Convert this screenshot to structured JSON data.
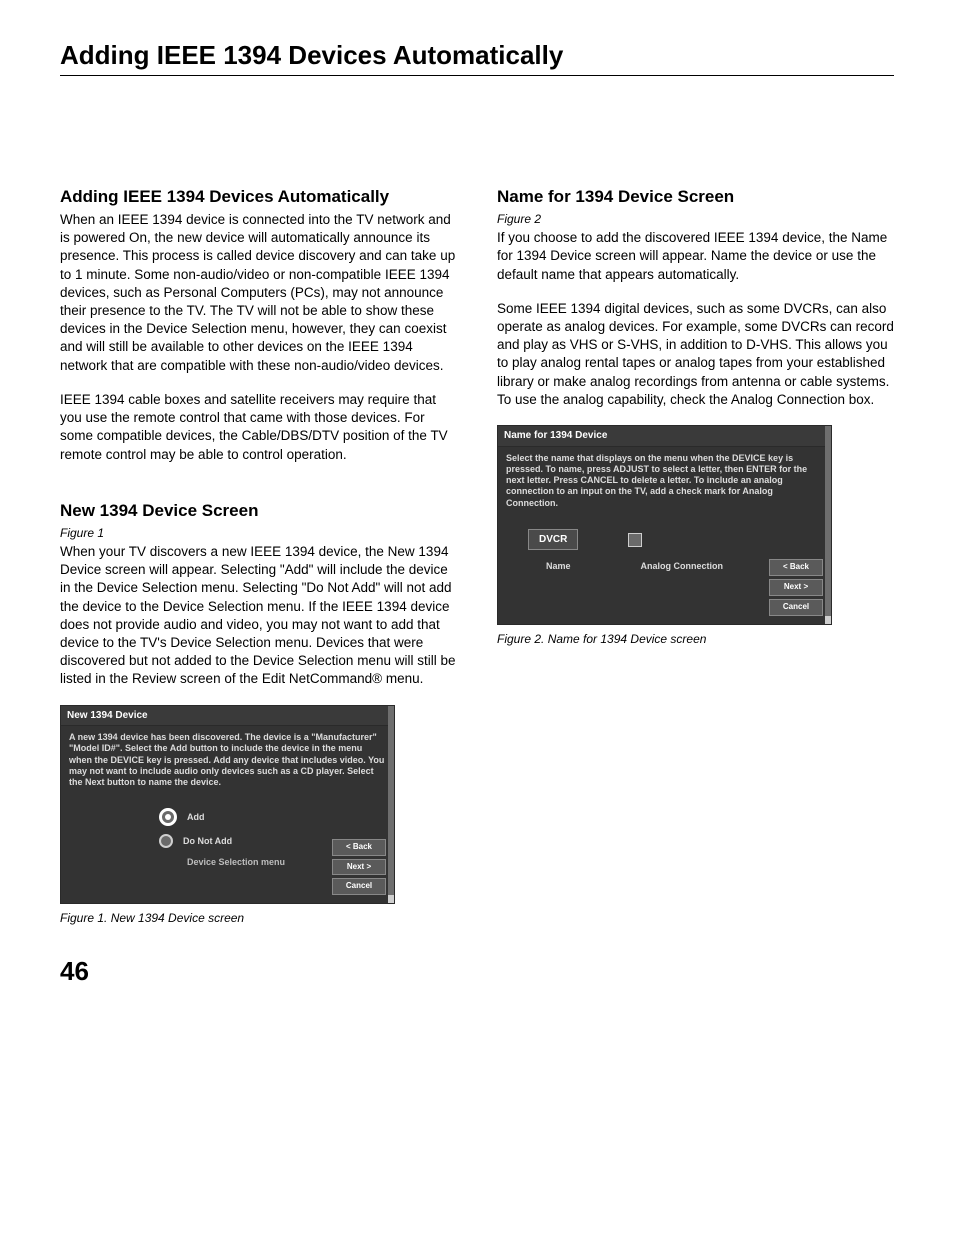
{
  "pageTitle": "Adding IEEE 1394 Devices Automatically",
  "pageNumber": "46",
  "left": {
    "s1": {
      "head": "Adding IEEE 1394 Devices Automatically",
      "p1": "When an IEEE 1394 device is connected into the TV network and is powered On, the new device will automatically announce its presence.  This process is called device discovery and can take up to 1 minute.  Some non-audio/video or non-compatible IEEE 1394 devices, such as Personal Computers (PCs), may not announce their presence to the TV.  The TV will not be able to show these devices in the Device Selection menu, however, they can coexist and will still be available to other devices on the IEEE 1394 network that are compatible with these non-audio/video devices.",
      "p2": "IEEE 1394 cable boxes and satellite receivers may require that you use the remote control that came with those devices.  For some compatible devices, the Cable/DBS/DTV position of the TV remote control may be able to control operation."
    },
    "s2": {
      "head": "New 1394 Device Screen",
      "figref": "Figure 1",
      "p1": "When your TV discovers a new IEEE 1394 device, the New 1394 Device screen will appear.  Selecting \"Add\" will include the device in the Device Selection menu.  Selecting \"Do Not Add\" will not add the device to the Device Selection menu.  If the IEEE 1394 device does not provide audio and video, you may not want to add that device to the TV's Device Selection menu.  Devices that were discovered but not added to the Device Selection menu will still be listed in the Review screen of the Edit NetCommand® menu."
    },
    "fig1": {
      "title": "New 1394 Device",
      "instr": "A new 1394 device has been discovered. The device is a \"Manufacturer\" \"Model ID#\".  Select the Add button to include the device in the menu when the DEVICE key is pressed.  Add any device that includes video. You may not want to include audio only devices such as a CD player. Select the Next button to name the device.",
      "opt1": "Add",
      "opt2": "Do Not Add",
      "sub": "Device Selection menu",
      "btn_back": "< Back",
      "btn_next": "Next >",
      "btn_cancel": "Cancel",
      "caption": "Figure 1. New 1394 Device screen"
    }
  },
  "right": {
    "s1": {
      "head": "Name for 1394 Device Screen",
      "figref": "Figure 2",
      "p1": "If you choose to add the discovered IEEE 1394 device, the Name for 1394 Device screen will appear.  Name the device or use the default name that appears automatically.",
      "p2": "Some IEEE 1394 digital devices, such as some DVCRs, can also operate as analog devices.  For example, some DVCRs can record and play as VHS or S-VHS, in addition to D-VHS.  This allows you to play analog rental tapes or analog tapes from your established library or make analog recordings from antenna or cable systems.  To use the analog capability, check the Analog Connection box."
    },
    "fig2": {
      "title": "Name for 1394 Device",
      "instr": "Select the name that displays on the menu when the DEVICE key is pressed.  To name, press ADJUST to select a letter, then ENTER for the next letter. Press CANCEL to delete a letter. To include an analog connection to an input on the TV, add a check mark for Analog Connection.",
      "nameValue": "DVCR",
      "nameLabel": "Name",
      "analogLabel": "Analog Connection",
      "btn_back": "< Back",
      "btn_next": "Next >",
      "btn_cancel": "Cancel",
      "caption": "Figure 2. Name for 1394 Device screen"
    }
  }
}
